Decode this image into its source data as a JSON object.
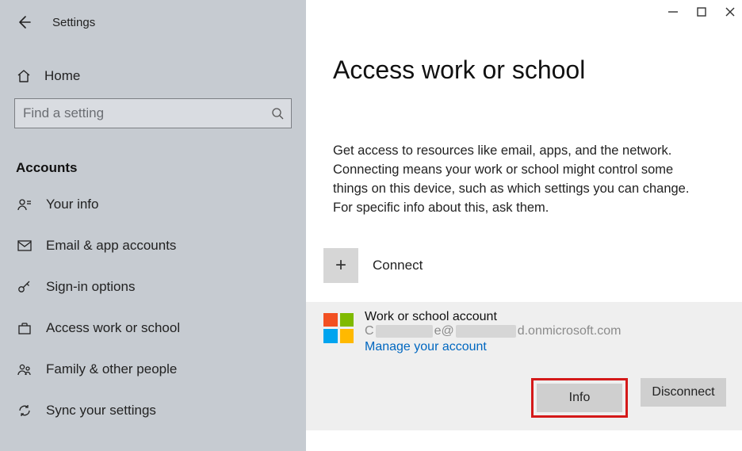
{
  "app": {
    "title": "Settings"
  },
  "sidebar": {
    "home_label": "Home",
    "search_placeholder": "Find a setting",
    "section_head": "Accounts",
    "items": [
      {
        "label": "Your info"
      },
      {
        "label": "Email & app accounts"
      },
      {
        "label": "Sign-in options"
      },
      {
        "label": "Access work or school"
      },
      {
        "label": "Family & other people"
      },
      {
        "label": "Sync your settings"
      }
    ]
  },
  "main": {
    "page_title": "Access work or school",
    "intro_text": "Get access to resources like email, apps, and the network. Connecting means your work or school might control some things on this device, such as which settings you can change. For specific info about this, ask them.",
    "connect_label": "Connect",
    "account": {
      "title": "Work or school account",
      "email_prefix": "C",
      "email_mid": "e@",
      "email_suffix": "d.onmicrosoft.com",
      "manage_link": "Manage your account",
      "info_btn": "Info",
      "disconnect_btn": "Disconnect"
    }
  }
}
